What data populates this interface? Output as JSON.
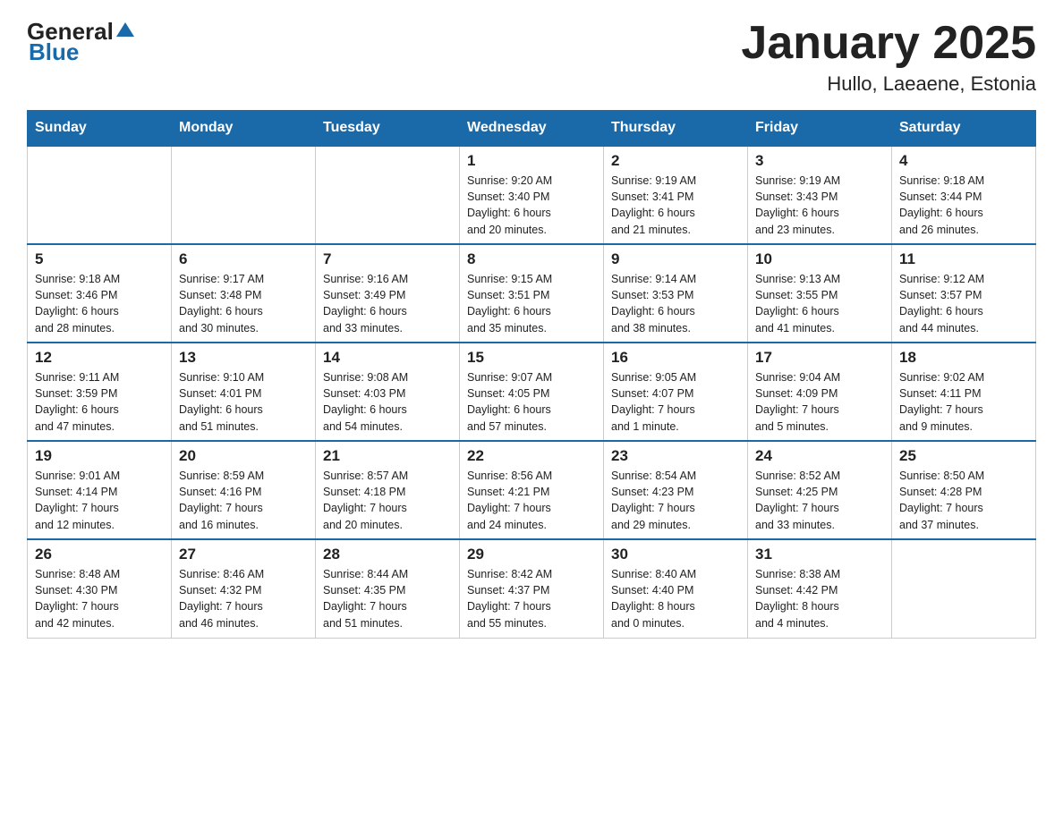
{
  "header": {
    "logo_general": "General",
    "logo_blue": "Blue",
    "month_title": "January 2025",
    "location": "Hullo, Laeaene, Estonia"
  },
  "weekdays": [
    "Sunday",
    "Monday",
    "Tuesday",
    "Wednesday",
    "Thursday",
    "Friday",
    "Saturday"
  ],
  "weeks": [
    [
      {
        "day": "",
        "info": ""
      },
      {
        "day": "",
        "info": ""
      },
      {
        "day": "",
        "info": ""
      },
      {
        "day": "1",
        "info": "Sunrise: 9:20 AM\nSunset: 3:40 PM\nDaylight: 6 hours\nand 20 minutes."
      },
      {
        "day": "2",
        "info": "Sunrise: 9:19 AM\nSunset: 3:41 PM\nDaylight: 6 hours\nand 21 minutes."
      },
      {
        "day": "3",
        "info": "Sunrise: 9:19 AM\nSunset: 3:43 PM\nDaylight: 6 hours\nand 23 minutes."
      },
      {
        "day": "4",
        "info": "Sunrise: 9:18 AM\nSunset: 3:44 PM\nDaylight: 6 hours\nand 26 minutes."
      }
    ],
    [
      {
        "day": "5",
        "info": "Sunrise: 9:18 AM\nSunset: 3:46 PM\nDaylight: 6 hours\nand 28 minutes."
      },
      {
        "day": "6",
        "info": "Sunrise: 9:17 AM\nSunset: 3:48 PM\nDaylight: 6 hours\nand 30 minutes."
      },
      {
        "day": "7",
        "info": "Sunrise: 9:16 AM\nSunset: 3:49 PM\nDaylight: 6 hours\nand 33 minutes."
      },
      {
        "day": "8",
        "info": "Sunrise: 9:15 AM\nSunset: 3:51 PM\nDaylight: 6 hours\nand 35 minutes."
      },
      {
        "day": "9",
        "info": "Sunrise: 9:14 AM\nSunset: 3:53 PM\nDaylight: 6 hours\nand 38 minutes."
      },
      {
        "day": "10",
        "info": "Sunrise: 9:13 AM\nSunset: 3:55 PM\nDaylight: 6 hours\nand 41 minutes."
      },
      {
        "day": "11",
        "info": "Sunrise: 9:12 AM\nSunset: 3:57 PM\nDaylight: 6 hours\nand 44 minutes."
      }
    ],
    [
      {
        "day": "12",
        "info": "Sunrise: 9:11 AM\nSunset: 3:59 PM\nDaylight: 6 hours\nand 47 minutes."
      },
      {
        "day": "13",
        "info": "Sunrise: 9:10 AM\nSunset: 4:01 PM\nDaylight: 6 hours\nand 51 minutes."
      },
      {
        "day": "14",
        "info": "Sunrise: 9:08 AM\nSunset: 4:03 PM\nDaylight: 6 hours\nand 54 minutes."
      },
      {
        "day": "15",
        "info": "Sunrise: 9:07 AM\nSunset: 4:05 PM\nDaylight: 6 hours\nand 57 minutes."
      },
      {
        "day": "16",
        "info": "Sunrise: 9:05 AM\nSunset: 4:07 PM\nDaylight: 7 hours\nand 1 minute."
      },
      {
        "day": "17",
        "info": "Sunrise: 9:04 AM\nSunset: 4:09 PM\nDaylight: 7 hours\nand 5 minutes."
      },
      {
        "day": "18",
        "info": "Sunrise: 9:02 AM\nSunset: 4:11 PM\nDaylight: 7 hours\nand 9 minutes."
      }
    ],
    [
      {
        "day": "19",
        "info": "Sunrise: 9:01 AM\nSunset: 4:14 PM\nDaylight: 7 hours\nand 12 minutes."
      },
      {
        "day": "20",
        "info": "Sunrise: 8:59 AM\nSunset: 4:16 PM\nDaylight: 7 hours\nand 16 minutes."
      },
      {
        "day": "21",
        "info": "Sunrise: 8:57 AM\nSunset: 4:18 PM\nDaylight: 7 hours\nand 20 minutes."
      },
      {
        "day": "22",
        "info": "Sunrise: 8:56 AM\nSunset: 4:21 PM\nDaylight: 7 hours\nand 24 minutes."
      },
      {
        "day": "23",
        "info": "Sunrise: 8:54 AM\nSunset: 4:23 PM\nDaylight: 7 hours\nand 29 minutes."
      },
      {
        "day": "24",
        "info": "Sunrise: 8:52 AM\nSunset: 4:25 PM\nDaylight: 7 hours\nand 33 minutes."
      },
      {
        "day": "25",
        "info": "Sunrise: 8:50 AM\nSunset: 4:28 PM\nDaylight: 7 hours\nand 37 minutes."
      }
    ],
    [
      {
        "day": "26",
        "info": "Sunrise: 8:48 AM\nSunset: 4:30 PM\nDaylight: 7 hours\nand 42 minutes."
      },
      {
        "day": "27",
        "info": "Sunrise: 8:46 AM\nSunset: 4:32 PM\nDaylight: 7 hours\nand 46 minutes."
      },
      {
        "day": "28",
        "info": "Sunrise: 8:44 AM\nSunset: 4:35 PM\nDaylight: 7 hours\nand 51 minutes."
      },
      {
        "day": "29",
        "info": "Sunrise: 8:42 AM\nSunset: 4:37 PM\nDaylight: 7 hours\nand 55 minutes."
      },
      {
        "day": "30",
        "info": "Sunrise: 8:40 AM\nSunset: 4:40 PM\nDaylight: 8 hours\nand 0 minutes."
      },
      {
        "day": "31",
        "info": "Sunrise: 8:38 AM\nSunset: 4:42 PM\nDaylight: 8 hours\nand 4 minutes."
      },
      {
        "day": "",
        "info": ""
      }
    ]
  ]
}
